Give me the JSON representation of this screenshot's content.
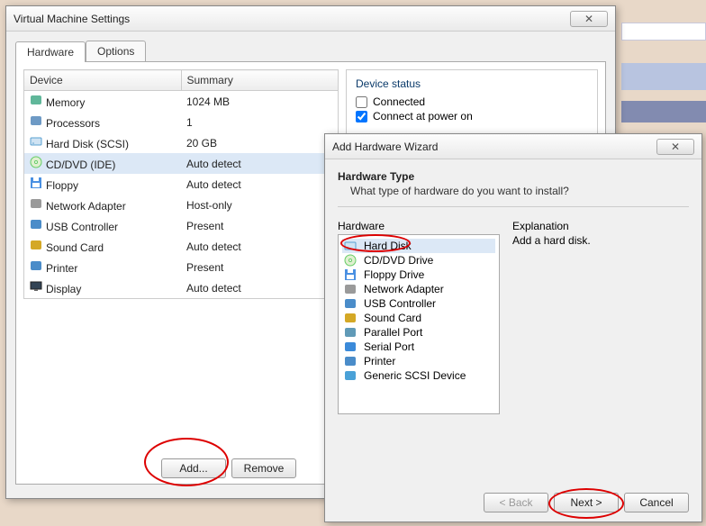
{
  "settings": {
    "title": "Virtual Machine Settings",
    "tabs": {
      "hardware": "Hardware",
      "options": "Options"
    },
    "columns": {
      "device": "Device",
      "summary": "Summary"
    },
    "devices": [
      {
        "name": "Memory",
        "summary": "1024 MB",
        "icon": "memory"
      },
      {
        "name": "Processors",
        "summary": "1",
        "icon": "cpu"
      },
      {
        "name": "Hard Disk (SCSI)",
        "summary": "20 GB",
        "icon": "hdd"
      },
      {
        "name": "CD/DVD (IDE)",
        "summary": "Auto detect",
        "icon": "cd",
        "selected": true
      },
      {
        "name": "Floppy",
        "summary": "Auto detect",
        "icon": "floppy"
      },
      {
        "name": "Network Adapter",
        "summary": "Host-only",
        "icon": "net"
      },
      {
        "name": "USB Controller",
        "summary": "Present",
        "icon": "usb"
      },
      {
        "name": "Sound Card",
        "summary": "Auto detect",
        "icon": "sound"
      },
      {
        "name": "Printer",
        "summary": "Present",
        "icon": "printer"
      },
      {
        "name": "Display",
        "summary": "Auto detect",
        "icon": "display"
      }
    ],
    "status": {
      "group": "Device status",
      "connected": "Connected",
      "connect_power": "Connect at power on",
      "connected_checked": false,
      "connect_power_checked": true
    },
    "buttons": {
      "add": "Add...",
      "remove": "Remove"
    }
  },
  "wizard": {
    "title": "Add Hardware Wizard",
    "heading": "Hardware Type",
    "sub": "What type of hardware do you want to install?",
    "list_label": "Hardware",
    "expl_label": "Explanation",
    "expl_text": "Add a hard disk.",
    "items": [
      {
        "name": "Hard Disk",
        "icon": "hdd",
        "selected": true
      },
      {
        "name": "CD/DVD Drive",
        "icon": "cd"
      },
      {
        "name": "Floppy Drive",
        "icon": "floppy"
      },
      {
        "name": "Network Adapter",
        "icon": "net"
      },
      {
        "name": "USB Controller",
        "icon": "usb"
      },
      {
        "name": "Sound Card",
        "icon": "sound"
      },
      {
        "name": "Parallel Port",
        "icon": "parallel"
      },
      {
        "name": "Serial Port",
        "icon": "serial"
      },
      {
        "name": "Printer",
        "icon": "printer"
      },
      {
        "name": "Generic SCSI Device",
        "icon": "scsi"
      }
    ],
    "buttons": {
      "back": "< Back",
      "next": "Next >",
      "cancel": "Cancel"
    }
  }
}
